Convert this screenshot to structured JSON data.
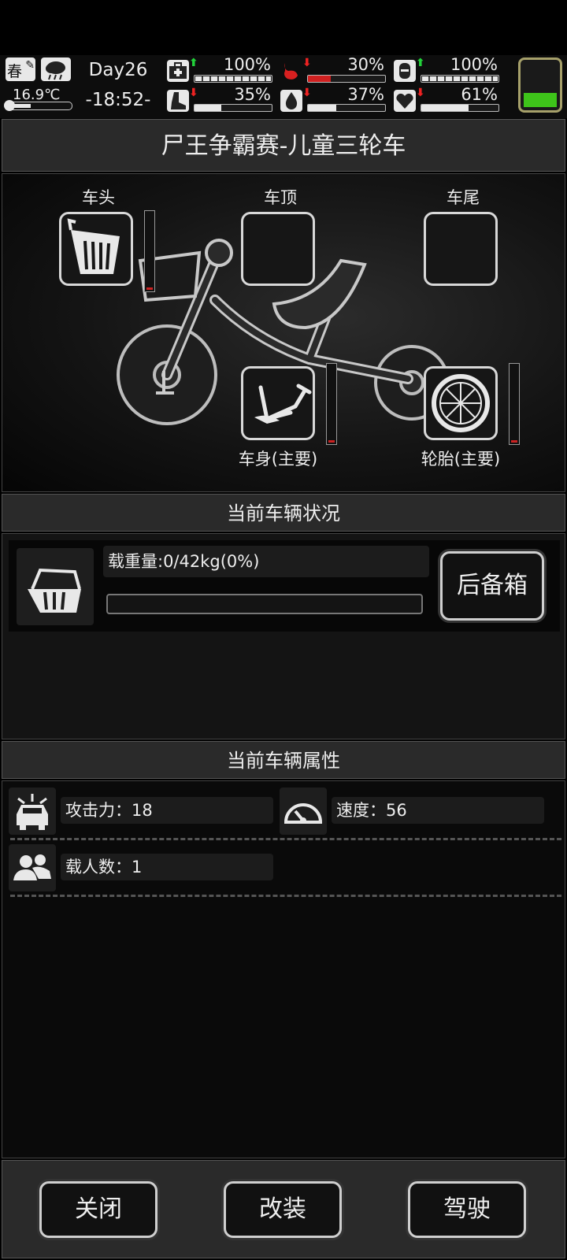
{
  "status": {
    "season": "春",
    "temperature": "16.9℃",
    "day": "Day26",
    "time": "-18:52-",
    "stats": [
      {
        "id": "health",
        "pct": "100%",
        "trend": "up",
        "level": 1.0,
        "color": "#e8e8e8"
      },
      {
        "id": "hunger",
        "pct": "30%",
        "trend": "down",
        "level": 0.3,
        "color": "#d02020"
      },
      {
        "id": "armor",
        "pct": "100%",
        "trend": "up",
        "level": 1.0,
        "color": "#e8e8e8"
      },
      {
        "id": "stamina",
        "pct": "35%",
        "trend": "down",
        "level": 0.35,
        "color": "#e8e8e8"
      },
      {
        "id": "water",
        "pct": "37%",
        "trend": "down",
        "level": 0.37,
        "color": "#e8e8e8"
      },
      {
        "id": "mood",
        "pct": "61%",
        "trend": "down",
        "level": 0.61,
        "color": "#e8e8e8"
      }
    ],
    "battery_level": 0.3,
    "battery_color": "#3ec41a"
  },
  "title": "尸王争霸赛-儿童三轮车",
  "slots": {
    "head": "车头",
    "roof": "车顶",
    "tail": "车尾",
    "body": "车身(主要)",
    "tire": "轮胎(主要)"
  },
  "status_section": {
    "title": "当前车辆状况",
    "load_text": "载重量:0/42kg(0%)",
    "load_level": 0,
    "trunk_button": "后备箱"
  },
  "attr_section": {
    "title": "当前车辆属性",
    "attack": "攻击力：18",
    "speed": "速度：56",
    "passengers": "载人数：1"
  },
  "buttons": {
    "close": "关闭",
    "modify": "改装",
    "drive": "驾驶"
  }
}
